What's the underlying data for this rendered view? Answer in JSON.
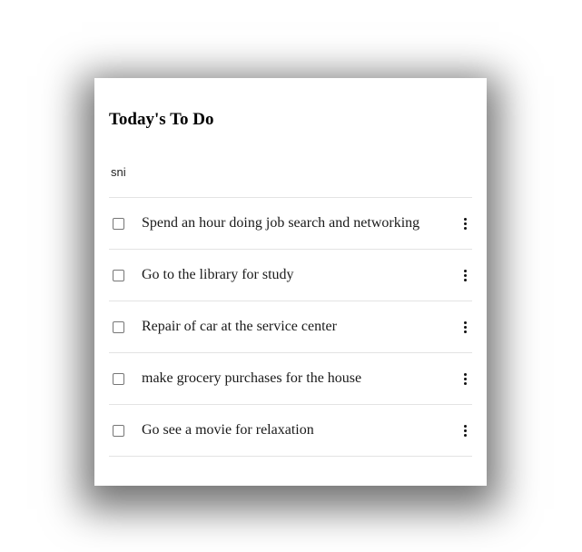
{
  "app": {
    "title": "Today's To Do"
  },
  "new_task": {
    "value": "sni"
  },
  "tasks": [
    {
      "label": "Spend an hour doing job search and networking",
      "checked": false,
      "menu_icon": "more-vertical-icon"
    },
    {
      "label": "Go to the library for study",
      "checked": false,
      "menu_icon": "more-vertical-icon"
    },
    {
      "label": "Repair of car at the service center",
      "checked": false,
      "menu_icon": "more-vertical-icon"
    },
    {
      "label": "make grocery purchases for the house",
      "checked": false,
      "menu_icon": "more-vertical-icon"
    },
    {
      "label": "Go see a movie for relaxation",
      "checked": false,
      "menu_icon": "more-vertical-icon"
    }
  ]
}
